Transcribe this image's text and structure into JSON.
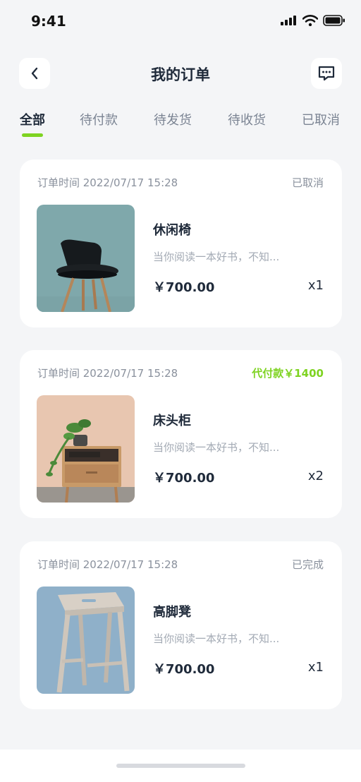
{
  "status_bar": {
    "time": "9:41"
  },
  "header": {
    "title": "我的订单"
  },
  "tabs": [
    {
      "label": "全部",
      "active": true
    },
    {
      "label": "待付款",
      "active": false
    },
    {
      "label": "待发货",
      "active": false
    },
    {
      "label": "待收货",
      "active": false
    },
    {
      "label": "已取消",
      "active": false
    }
  ],
  "colors": {
    "accent": "#7ed321",
    "background": "#f4f5f7",
    "card": "#ffffff",
    "text_primary": "#1f2a3a",
    "text_secondary": "#8a919d"
  },
  "orders": [
    {
      "time": "订单时间 2022/07/17 15:28",
      "status": "已取消",
      "product_name": "休闲椅",
      "description": "当你阅读一本好书，不知...",
      "price": "￥700.00",
      "quantity": "x1",
      "image": "black-chair-image"
    },
    {
      "time": "订单时间 2022/07/17 15:28",
      "status": "代付款￥1400",
      "product_name": "床头柜",
      "description": "当你阅读一本好书，不知...",
      "price": "￥700.00",
      "quantity": "x2",
      "image": "nightstand-with-plant-image"
    },
    {
      "time": "订单时间 2022/07/17 15:28",
      "status": "已完成",
      "product_name": "高脚凳",
      "description": "当你阅读一本好书，不知...",
      "price": "￥700.00",
      "quantity": "x1",
      "image": "wooden-stool-image"
    }
  ]
}
